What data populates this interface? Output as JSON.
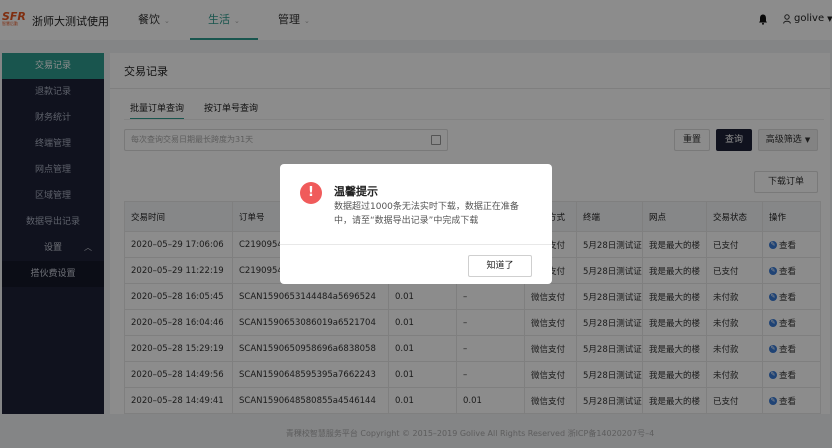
{
  "header": {
    "logo_text": "SFR",
    "logo_sub": "智慧后勤",
    "app_title": "浙师大测试使用",
    "nav": [
      {
        "label": "餐饮",
        "has_caret": true
      },
      {
        "label": "生活",
        "has_caret": true
      },
      {
        "label": "管理",
        "has_caret": true
      }
    ],
    "user": "golive"
  },
  "sidebar": {
    "items": [
      {
        "label": "交易记录"
      },
      {
        "label": "退款记录"
      },
      {
        "label": "财务统计"
      },
      {
        "label": "终端管理"
      },
      {
        "label": "网点管理"
      },
      {
        "label": "区域管理"
      },
      {
        "label": "数据导出记录"
      },
      {
        "label": "设置"
      },
      {
        "label": "搭伙费设置"
      }
    ]
  },
  "main": {
    "title": "交易记录",
    "tabs": [
      {
        "label": "批量订单查询"
      },
      {
        "label": "按订单号查询"
      }
    ],
    "date_placeholder": "每次查询交易日期最长跨度为31天",
    "buttons": {
      "reset": "重置",
      "search": "查询",
      "advanced": "高级筛选",
      "download": "下载订单"
    }
  },
  "table": {
    "headers": [
      "交易时间",
      "订单号",
      "",
      "",
      "支付方式",
      "终端",
      "网点",
      "交易状态",
      "操作"
    ],
    "rows": [
      [
        "2020–05–29 17:06:06",
        "C2190954",
        "",
        "",
        "微信支付",
        "5月28日测试证",
        "我是最大的楼",
        "已支付",
        "查看"
      ],
      [
        "2020–05–29 11:22:19",
        "C2190954",
        "",
        "",
        "微信支付",
        "5月28日测试证",
        "我是最大的楼",
        "已支付",
        "查看"
      ],
      [
        "2020–05–28 16:05:45",
        "SCAN1590653144484a5696524",
        "0.01",
        "–",
        "微信支付",
        "5月28日测试证",
        "我是最大的楼",
        "未付款",
        "查看"
      ],
      [
        "2020–05–28 16:04:46",
        "SCAN1590653086019a6521704",
        "0.01",
        "–",
        "微信支付",
        "5月28日测试证",
        "我是最大的楼",
        "未付款",
        "查看"
      ],
      [
        "2020–05–28 15:29:19",
        "SCAN1590650958696a6838058",
        "0.01",
        "–",
        "微信支付",
        "5月28日测试证",
        "我是最大的楼",
        "未付款",
        "查看"
      ],
      [
        "2020–05–28 14:49:56",
        "SCAN1590648595395a7662243",
        "0.01",
        "–",
        "微信支付",
        "5月28日测试证",
        "我是最大的楼",
        "未付款",
        "查看"
      ],
      [
        "2020–05–28 14:49:41",
        "SCAN1590648580855a4546144",
        "0.01",
        "0.01",
        "微信支付",
        "5月28日测试证",
        "我是最大的楼",
        "已支付",
        "查看"
      ]
    ]
  },
  "modal": {
    "icon": "!",
    "title": "温馨提示",
    "body": "数据超过1000条无法实时下载，数据正在准备中，请至“数据导出记录”中完成下载",
    "confirm": "知道了"
  },
  "footer": "青稞校智慧服务平台 Copyright © 2015–2019 Golive All Rights Reserved 浙ICP备14020207号–4"
}
